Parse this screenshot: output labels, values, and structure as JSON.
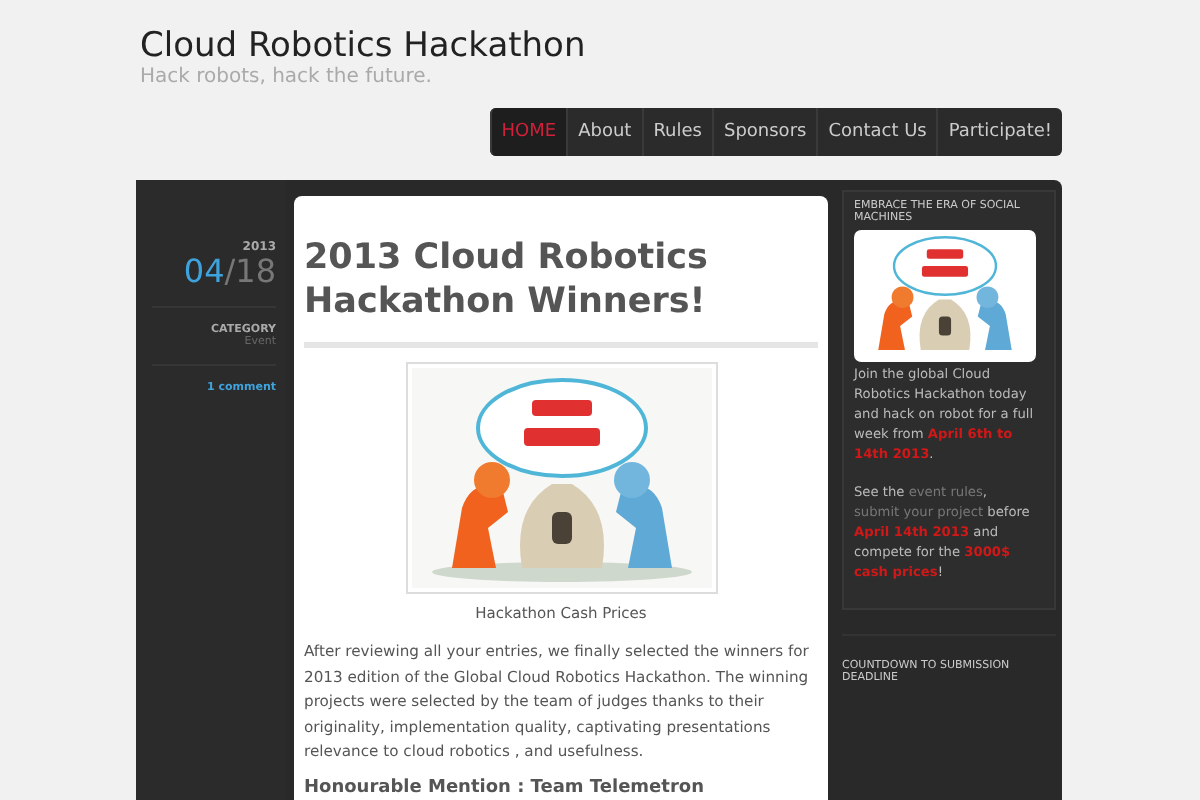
{
  "site": {
    "title": "Cloud Robotics Hackathon",
    "tagline": "Hack robots, hack the future."
  },
  "nav": [
    {
      "label": "HOME",
      "selected": true
    },
    {
      "label": "About",
      "selected": false
    },
    {
      "label": "Rules",
      "selected": false
    },
    {
      "label": "Sponsors",
      "selected": false
    },
    {
      "label": "Contact Us",
      "selected": false
    },
    {
      "label": "Participate!",
      "selected": false
    }
  ],
  "post_meta": {
    "year": "2013",
    "month": "04",
    "day": "/18",
    "category_label": "CATEGORY",
    "category": "Event",
    "comments": "1 comment"
  },
  "post": {
    "title": "2013 Cloud Robotics Hackathon Winners!",
    "caption": "Hackathon Cash Prices",
    "body": "After reviewing all your entries, we finally selected the winners for 2013 edition of the Global Cloud Robotics Hackathon. The winning projects were selected by the team of judges thanks to their originality, implementation quality,  captivating presentations relevance to cloud robotics , and usefulness.",
    "subheading": "Honourable Mention : Team Telemetron"
  },
  "sidebar": [
    {
      "title": "EMBRACE THE ERA OF SOCIAL MACHINES",
      "intro": "Join the global Cloud Robotics Hackathon today and hack on robot for a full week from **April 6th to 14th 2013**.",
      "segments": [
        {
          "kind": "plain",
          "text": "See the "
        },
        {
          "kind": "link",
          "text": "event rules"
        },
        {
          "kind": "plain",
          "text": ", "
        },
        {
          "kind": "link",
          "text": "submit your project"
        },
        {
          "kind": "plain",
          "text": " before "
        },
        {
          "kind": "strong",
          "text": "April 14th 2013"
        },
        {
          "kind": "plain",
          "text": " and compete for the "
        },
        {
          "kind": "strong",
          "text": "3000$ cash prices"
        },
        {
          "kind": "plain",
          "text": "!"
        }
      ]
    },
    {
      "title": "COUNTDOWN TO SUBMISSION DEADLINE"
    }
  ]
}
